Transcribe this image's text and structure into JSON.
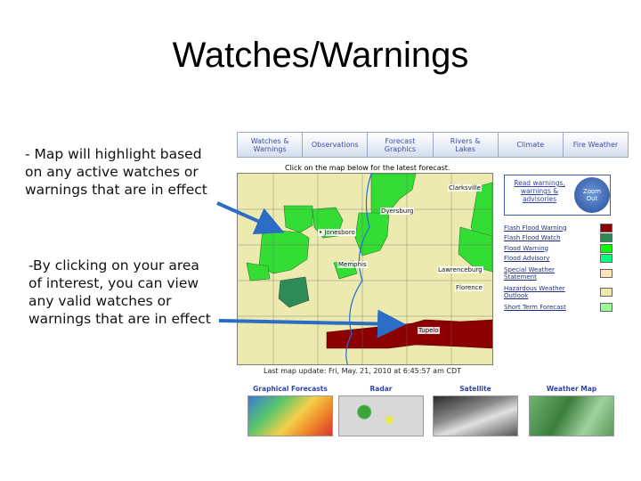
{
  "slide": {
    "title": "Watches/Warnings",
    "bullet_1": "- Map will highlight based\non any active watches or\nwarnings that are in effect",
    "bullet_2": "-By clicking on your area\nof interest, you can view\nany valid watches or\nwarnings that are in effect"
  },
  "nav": {
    "tabs": [
      "Watches &\nWarnings",
      "Observations",
      "Forecast\nGraphics",
      "Rivers &\nLakes",
      "Climate",
      "Fire Weather"
    ]
  },
  "map": {
    "caption": "Click on the map below for the latest forecast.",
    "cities": [
      "Clarksville",
      "Dyersburg",
      "• Jonesboro",
      "Memphis",
      "Lawrenceburg",
      "Florence",
      "Tupelo"
    ],
    "last_update": "Last map update: Fri, May. 21, 2010 at 6:45:57 am CDT"
  },
  "panel": {
    "read_link": "Read warnings,\nwarnings &\nadvisories",
    "zoom_label": "Zoom\nOut"
  },
  "legend": [
    {
      "label": "Flash Flood Warning",
      "color": "#8b0000"
    },
    {
      "label": "Flash Flood Watch",
      "color": "#2e8b57"
    },
    {
      "label": "Flood Warning",
      "color": "#00ff00"
    },
    {
      "label": "Flood Advisory",
      "color": "#00ff7f"
    },
    {
      "label": "Special Weather\nStatement",
      "color": "#ffe4b5"
    },
    {
      "label": "Hazardous Weather\nOutlook",
      "color": "#eee8aa"
    },
    {
      "label": "Short Term Forecast",
      "color": "#98fb98"
    }
  ],
  "thumbnails": [
    "Graphical Forecasts",
    "Radar",
    "Satellite",
    "Weather Map"
  ],
  "colors": {
    "flash_flood_warning": "#8b0000",
    "flood_warning": "#33dd33",
    "flash_flood_watch": "#2e8b57",
    "arrow": "#2b6cc4"
  }
}
